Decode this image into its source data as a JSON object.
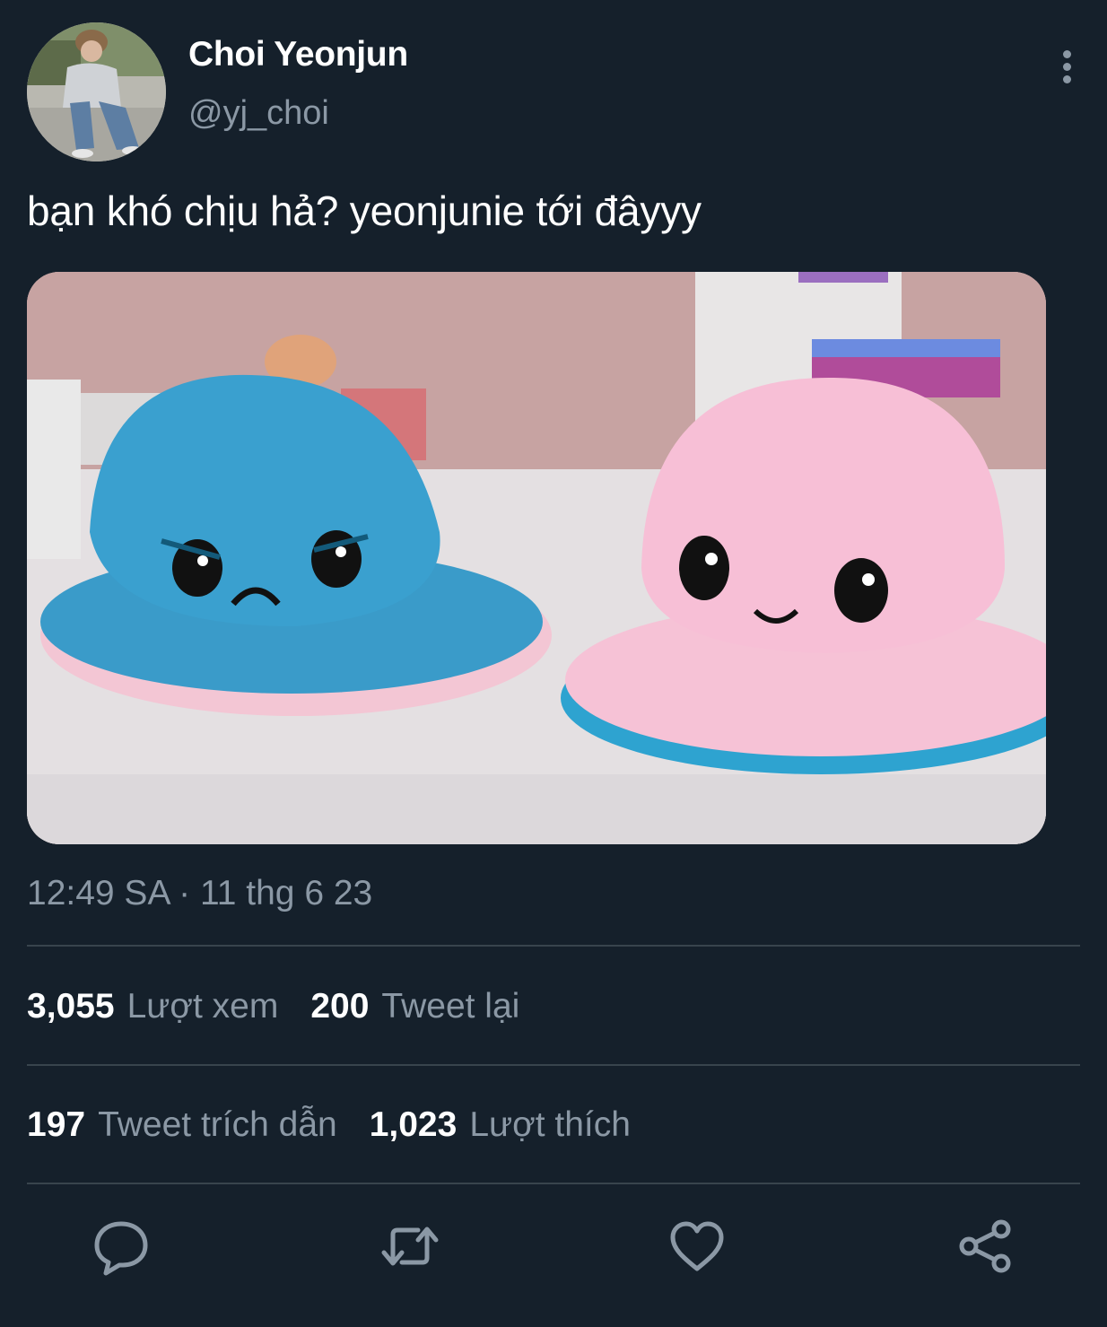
{
  "author": {
    "display_name": "Choi Yeonjun",
    "handle": "@yj_choi"
  },
  "tweet": {
    "text": "bạn khó chịu hả? yeonjunie tới đâyyy",
    "timestamp": "12:49 SA · 11 thg 6 23"
  },
  "stats": {
    "views_count": "3,055",
    "views_label": "Lượt xem",
    "retweets_count": "200",
    "retweets_label": "Tweet lại",
    "quotes_count": "197",
    "quotes_label": "Tweet trích dẫn",
    "likes_count": "1,023",
    "likes_label": "Lượt thích"
  },
  "icons": {
    "more": "more-vertical-icon",
    "reply": "reply-icon",
    "retweet": "retweet-icon",
    "like": "heart-icon",
    "share": "share-icon"
  },
  "colors": {
    "background": "#15202b",
    "text_primary": "#ffffff",
    "text_secondary": "#8b98a5",
    "divider": "#38444d"
  }
}
